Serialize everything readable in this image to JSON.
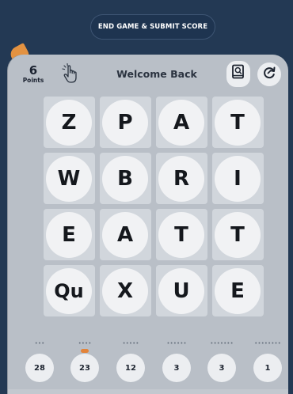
{
  "header": {
    "submit_label": "END GAME & SUBMIT SCORE"
  },
  "score": {
    "value": "6",
    "label": "Points"
  },
  "greeting": "Welcome Back",
  "icons": {
    "hand": "tap-hand-icon",
    "book": "word-list-icon",
    "refresh": "rotate-board-icon"
  },
  "board": {
    "rows": [
      [
        "Z",
        "P",
        "A",
        "T"
      ],
      [
        "W",
        "B",
        "R",
        "I"
      ],
      [
        "E",
        "A",
        "T",
        "T"
      ],
      [
        "Qu",
        "X",
        "U",
        "E"
      ]
    ]
  },
  "word_counts": [
    {
      "dots": "•••",
      "count": "28",
      "active": false
    },
    {
      "dots": "••••",
      "count": "23",
      "active": true
    },
    {
      "dots": "•••••",
      "count": "12",
      "active": false
    },
    {
      "dots": "••••••",
      "count": "3",
      "active": false
    },
    {
      "dots": "•••••••",
      "count": "3",
      "active": false
    },
    {
      "dots": "••••••••",
      "count": "1",
      "active": false
    }
  ],
  "colors": {
    "background": "#233954",
    "panel": "#b9bfc7",
    "accent": "#e3843a"
  }
}
